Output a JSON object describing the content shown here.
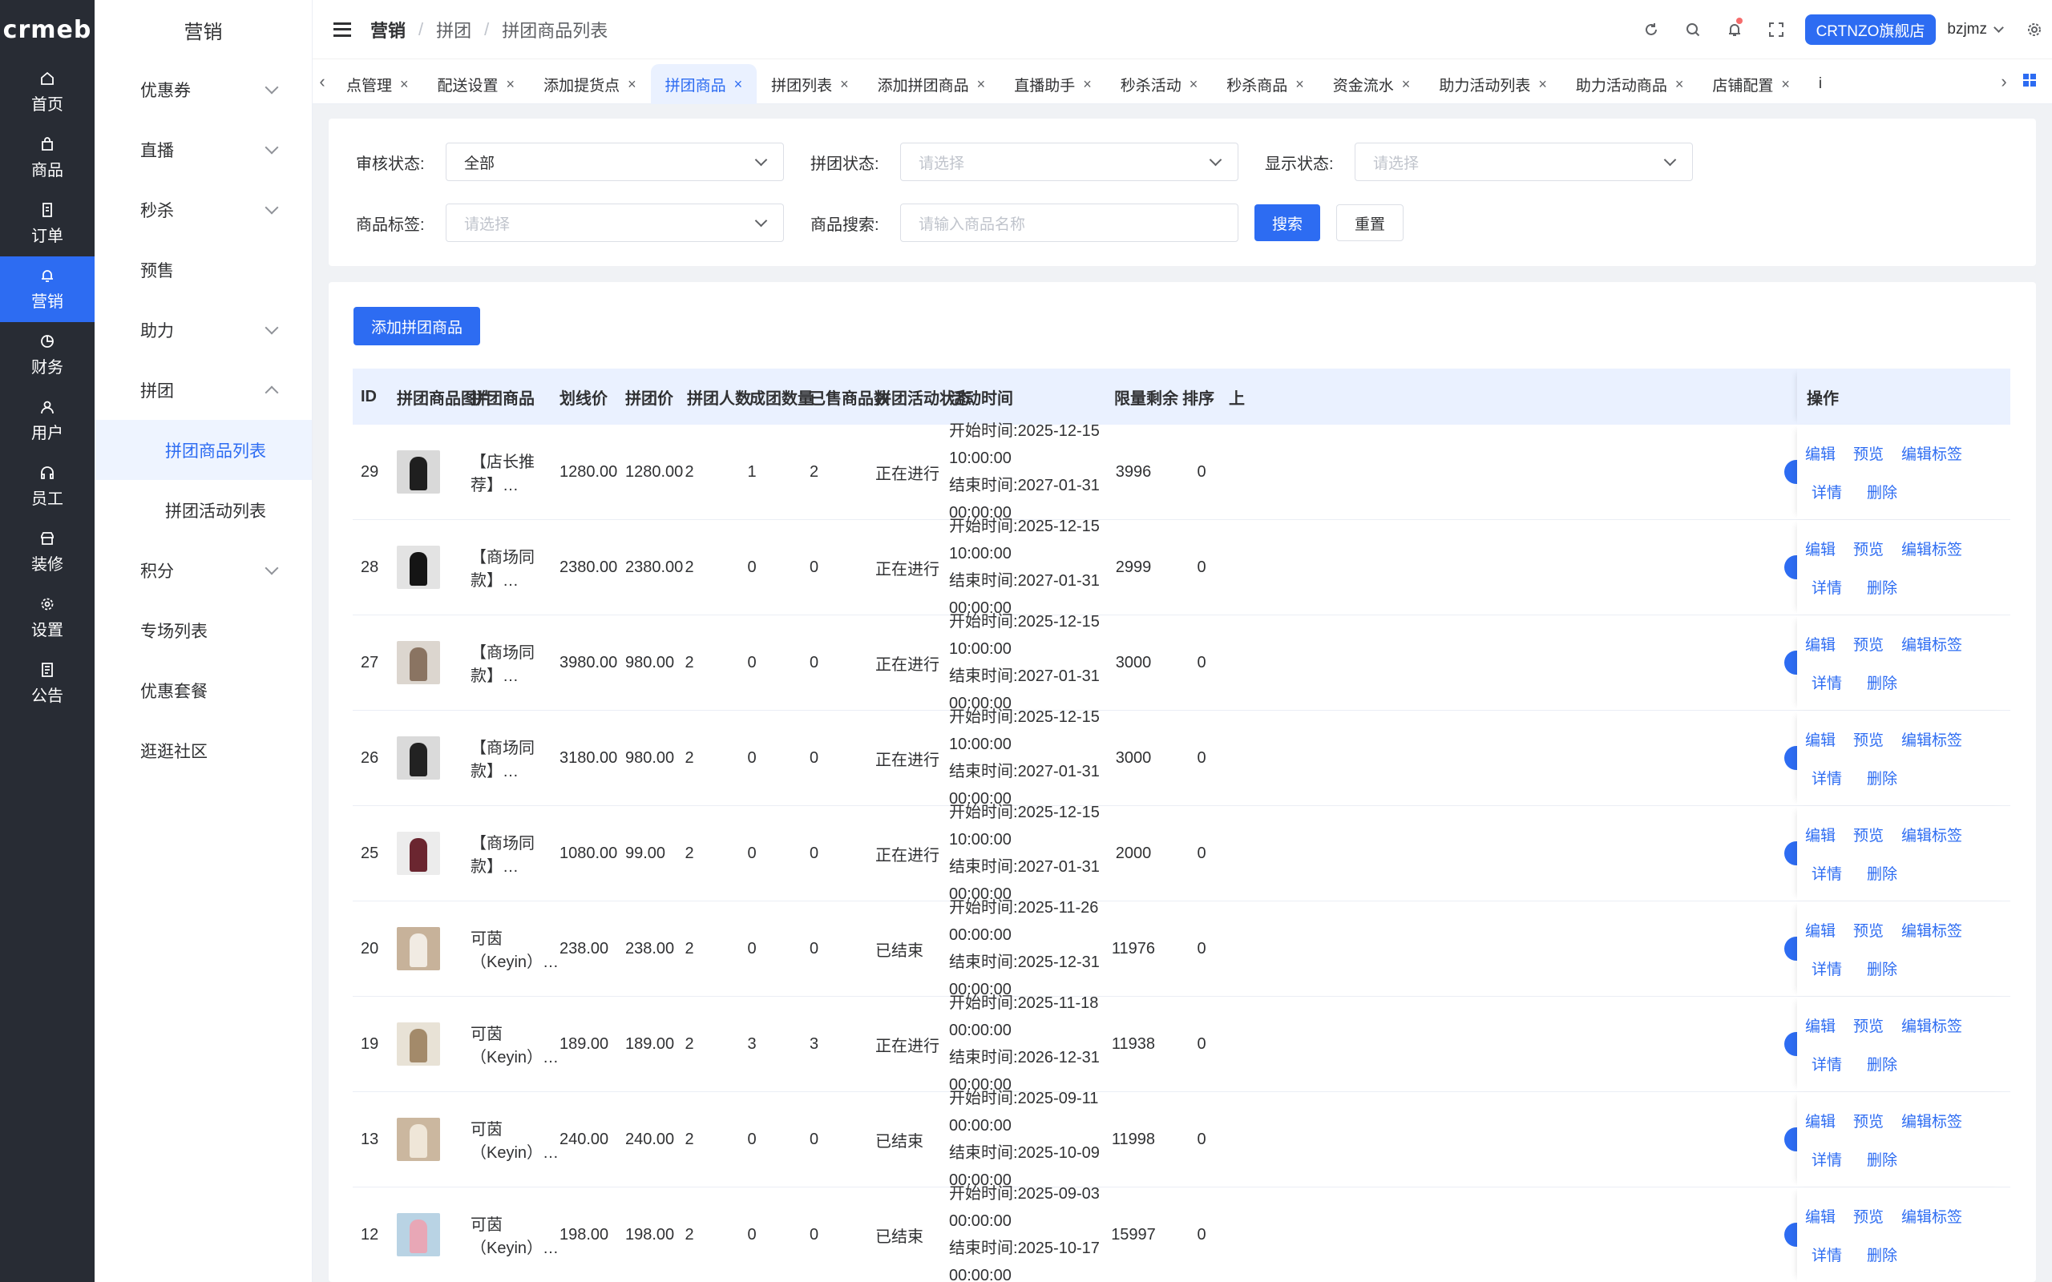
{
  "logo": "crmeb",
  "rail": [
    {
      "label": "首页",
      "icon": "home-icon"
    },
    {
      "label": "商品",
      "icon": "bag-icon"
    },
    {
      "label": "订单",
      "icon": "order-icon"
    },
    {
      "label": "营销",
      "icon": "bell-icon",
      "active": true
    },
    {
      "label": "财务",
      "icon": "pie-icon"
    },
    {
      "label": "用户",
      "icon": "user-icon"
    },
    {
      "label": "员工",
      "icon": "headset-icon"
    },
    {
      "label": "装修",
      "icon": "store-icon"
    },
    {
      "label": "设置",
      "icon": "gear-icon"
    },
    {
      "label": "公告",
      "icon": "notice-icon"
    }
  ],
  "menu": {
    "title": "营销",
    "items": [
      {
        "label": "优惠券",
        "chev": "down"
      },
      {
        "label": "直播",
        "chev": "down"
      },
      {
        "label": "秒杀",
        "chev": "down"
      },
      {
        "label": "预售"
      },
      {
        "label": "助力",
        "chev": "down"
      },
      {
        "label": "拼团",
        "chev": "up"
      },
      {
        "label": "拼团商品列表",
        "sub": true,
        "active": true
      },
      {
        "label": "拼团活动列表",
        "sub": true
      },
      {
        "label": "积分",
        "chev": "down"
      },
      {
        "label": "专场列表"
      },
      {
        "label": "优惠套餐"
      },
      {
        "label": "逛逛社区"
      }
    ]
  },
  "header": {
    "crumb": [
      "营销",
      "拼团",
      "拼团商品列表"
    ],
    "store": "CRTNZO旗舰店",
    "user": "bzjmz"
  },
  "tabs": [
    {
      "label": "点管理"
    },
    {
      "label": "配送设置"
    },
    {
      "label": "添加提货点"
    },
    {
      "label": "拼团商品",
      "active": true
    },
    {
      "label": "拼团列表"
    },
    {
      "label": "添加拼团商品"
    },
    {
      "label": "直播助手"
    },
    {
      "label": "秒杀活动"
    },
    {
      "label": "秒杀商品"
    },
    {
      "label": "资金流水"
    },
    {
      "label": "助力活动列表"
    },
    {
      "label": "助力活动商品"
    },
    {
      "label": "店铺配置"
    },
    {
      "label": "i"
    }
  ],
  "filters": {
    "audit_label": "审核状态:",
    "audit_value": "全部",
    "group_label": "拼团状态:",
    "group_placeholder": "请选择",
    "show_label": "显示状态:",
    "show_placeholder": "请选择",
    "tag_label": "商品标签:",
    "tag_placeholder": "请选择",
    "search_label": "商品搜索:",
    "search_placeholder": "请输入商品名称",
    "search_btn": "搜索",
    "reset_btn": "重置"
  },
  "table": {
    "add_btn": "添加拼团商品",
    "columns": [
      "ID",
      "拼团商品图片",
      "拼团商品",
      "划线价",
      "拼团价",
      "拼团人数",
      "成团数量",
      "已售商品数",
      "拼团活动状态",
      "活动时间",
      "限量剩余",
      "排序",
      "上",
      "操作"
    ],
    "time_start_prefix": "开始时间:",
    "time_end_prefix": "结束时间:",
    "actions": [
      "编辑",
      "预览",
      "编辑标签",
      "详情",
      "删除"
    ],
    "rows": [
      {
        "id": "29",
        "name": "【店长推荐】…",
        "orig": "1280.00",
        "price": "1280.00",
        "people": "2",
        "groups": "1",
        "sold": "2",
        "status": "正在进行",
        "start": "2025-12-15 10:00:00",
        "end": "2027-01-31 00:00:00",
        "remain": "3996",
        "sort": "0",
        "img": [
          "#d9d9d9",
          "#1f1f1f"
        ]
      },
      {
        "id": "28",
        "name": "【商场同款】…",
        "orig": "2380.00",
        "price": "2380.00",
        "people": "2",
        "groups": "0",
        "sold": "0",
        "status": "正在进行",
        "start": "2025-12-15 10:00:00",
        "end": "2027-01-31 00:00:00",
        "remain": "2999",
        "sort": "0",
        "img": [
          "#e3e3e3",
          "#151515"
        ]
      },
      {
        "id": "27",
        "name": "【商场同款】…",
        "orig": "3980.00",
        "price": "980.00",
        "people": "2",
        "groups": "0",
        "sold": "0",
        "status": "正在进行",
        "start": "2025-12-15 10:00:00",
        "end": "2027-01-31 00:00:00",
        "remain": "3000",
        "sort": "0",
        "img": [
          "#dcd6cf",
          "#8a7462"
        ]
      },
      {
        "id": "26",
        "name": "【商场同款】…",
        "orig": "3180.00",
        "price": "980.00",
        "people": "2",
        "groups": "0",
        "sold": "0",
        "status": "正在进行",
        "start": "2025-12-15 10:00:00",
        "end": "2027-01-31 00:00:00",
        "remain": "3000",
        "sort": "0",
        "img": [
          "#dadada",
          "#222222"
        ]
      },
      {
        "id": "25",
        "name": "【商场同款】…",
        "orig": "1080.00",
        "price": "99.00",
        "people": "2",
        "groups": "0",
        "sold": "0",
        "status": "正在进行",
        "start": "2025-12-15 10:00:00",
        "end": "2027-01-31 00:00:00",
        "remain": "2000",
        "sort": "0",
        "img": [
          "#ececec",
          "#6b2630"
        ]
      },
      {
        "id": "20",
        "name": "可茵（Keyin）…",
        "orig": "238.00",
        "price": "238.00",
        "people": "2",
        "groups": "0",
        "sold": "0",
        "status": "已结束",
        "start": "2025-11-26 00:00:00",
        "end": "2025-12-31 00:00:00",
        "remain": "11976",
        "sort": "0",
        "img": [
          "#c7b29a",
          "#f1ebe3"
        ]
      },
      {
        "id": "19",
        "name": "可茵（Keyin）…",
        "orig": "189.00",
        "price": "189.00",
        "people": "2",
        "groups": "3",
        "sold": "3",
        "status": "正在进行",
        "start": "2025-11-18 00:00:00",
        "end": "2026-12-31 00:00:00",
        "remain": "11938",
        "sort": "0",
        "img": [
          "#e8e2d6",
          "#a38a6a"
        ]
      },
      {
        "id": "13",
        "name": "可茵（Keyin）…",
        "orig": "240.00",
        "price": "240.00",
        "people": "2",
        "groups": "0",
        "sold": "0",
        "status": "已结束",
        "start": "2025-09-11 00:00:00",
        "end": "2025-10-09 00:00:00",
        "remain": "11998",
        "sort": "0",
        "img": [
          "#cbb79f",
          "#efe6d8"
        ]
      },
      {
        "id": "12",
        "name": "可茵（Keyin）…",
        "orig": "198.00",
        "price": "198.00",
        "people": "2",
        "groups": "0",
        "sold": "0",
        "status": "已结束",
        "start": "2025-09-03 00:00:00",
        "end": "2025-10-17 00:00:00",
        "remain": "15997",
        "sort": "0",
        "img": [
          "#b9d3e4",
          "#e8a7b6"
        ]
      }
    ]
  }
}
